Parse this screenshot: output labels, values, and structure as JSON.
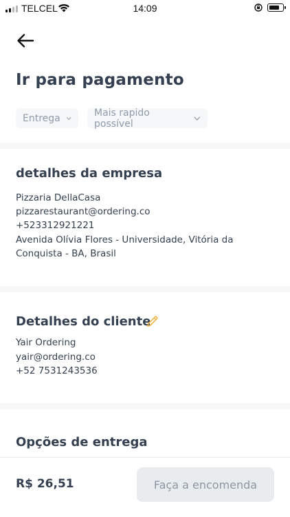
{
  "status_bar": {
    "carrier": "TELCEL",
    "time": "14:09",
    "battery_level": 0.8
  },
  "header": {
    "back_icon": "arrow-left-icon",
    "title": "Ir para pagamento"
  },
  "filters": {
    "delivery_label": "Entrega",
    "time_label": "Mais rapido possível"
  },
  "business": {
    "title": "detalhes da empresa",
    "name": "Pizzaria DellaCasa",
    "email": "pizzarestaurant@ordering.co",
    "phone": "+523312921221",
    "address_line1": "Avenida Olívia Flores - Universidade, Vitória da",
    "address_line2": "Conquista - BA, Brasil"
  },
  "customer": {
    "title": "Detalhes do cliente",
    "edit_icon": "pencil-icon",
    "name": "Yair  Ordering",
    "email": "yair@ordering.co",
    "phone": "+52 7531243536"
  },
  "delivery_options": {
    "title": "Opções de entrega"
  },
  "footer": {
    "total": "R$ 26,51",
    "order_button": "Faça a encomenda"
  },
  "colors": {
    "text": "#344050",
    "muted": "#909ba9",
    "accent_edit": "#f2b33d",
    "button_bg": "#e9ecef"
  }
}
